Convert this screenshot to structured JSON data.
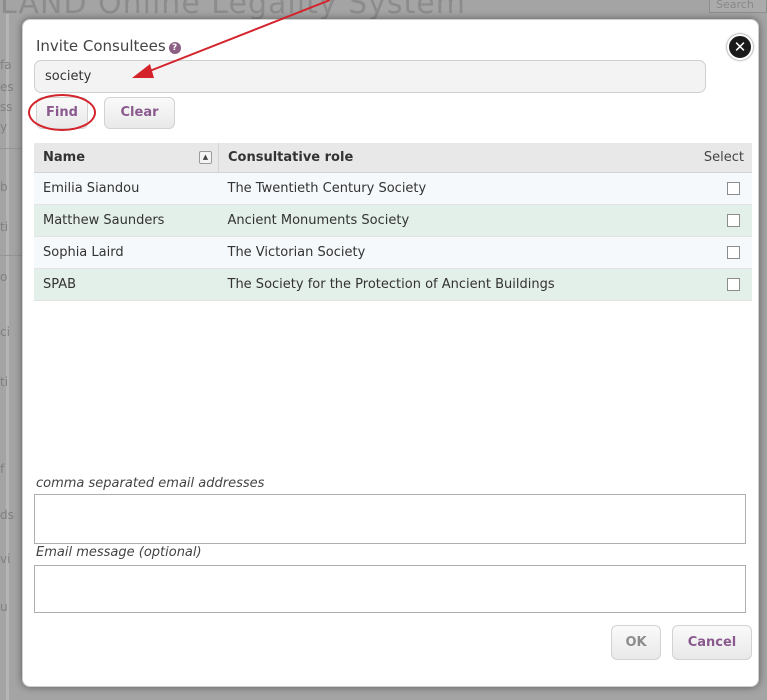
{
  "background": {
    "title_fragment": "LAND    Online Legality System",
    "search_fragment": "Search"
  },
  "dialog": {
    "title": "Invite Consultees",
    "help_icon": "question-circle-icon",
    "close_icon": "close-circle-icon"
  },
  "search": {
    "value": "society"
  },
  "buttons": {
    "find": "Find",
    "clear": "Clear",
    "ok": "OK",
    "cancel": "Cancel"
  },
  "table": {
    "columns": {
      "name": "Name",
      "role": "Consultative role",
      "select": "Select"
    },
    "sort_icon": "sort-up-icon",
    "rows": [
      {
        "name": "Emilia Siandou",
        "role": "The Twentieth Century Society",
        "selected": false
      },
      {
        "name": "Matthew Saunders",
        "role": "Ancient Monuments Society",
        "selected": false
      },
      {
        "name": "Sophia Laird",
        "role": "The Victorian Society",
        "selected": false
      },
      {
        "name": "SPAB",
        "role": "The Society for the Protection of Ancient Buildings",
        "selected": false
      }
    ]
  },
  "emails": {
    "label": "comma separated email addresses",
    "value": ""
  },
  "message": {
    "label": "Email message (optional)",
    "value": ""
  },
  "colors": {
    "accent": "#8a5a8e",
    "row_alt": "#e3efe9",
    "annotation": "#d4232b"
  }
}
